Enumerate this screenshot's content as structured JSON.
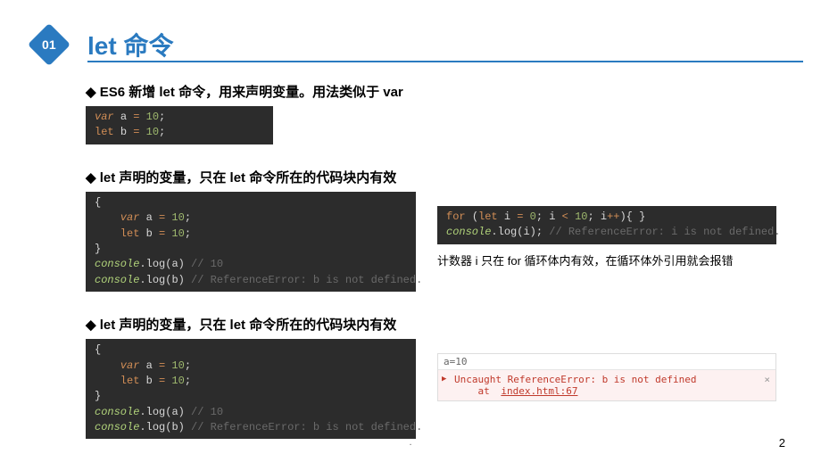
{
  "slide": {
    "badge": "01",
    "title": "let 命令",
    "page_number": "2",
    "footer_mark": "."
  },
  "sections": [
    {
      "heading": "ES6 新增 let 命令，用来声明变量。用法类似于 var",
      "code1": [
        {
          "segments": [
            {
              "t": "var ",
              "c": "kw-orange"
            },
            {
              "t": "a ",
              "c": "varname"
            },
            {
              "t": "= ",
              "c": "op"
            },
            {
              "t": "10",
              "c": "num"
            },
            {
              "t": ";",
              "c": "varname"
            }
          ]
        },
        {
          "segments": [
            {
              "t": "let ",
              "c": "kw-let"
            },
            {
              "t": "b ",
              "c": "varname"
            },
            {
              "t": "= ",
              "c": "op"
            },
            {
              "t": "10",
              "c": "num"
            },
            {
              "t": ";",
              "c": "varname"
            }
          ]
        }
      ]
    },
    {
      "heading": "let 声明的变量，只在 let 命令所在的代码块内有效",
      "code_left": [
        {
          "segments": [
            {
              "t": "{",
              "c": "varname"
            }
          ]
        },
        {
          "segments": [
            {
              "t": "    var ",
              "c": "kw-orange"
            },
            {
              "t": "a ",
              "c": "varname"
            },
            {
              "t": "= ",
              "c": "op"
            },
            {
              "t": "10",
              "c": "num"
            },
            {
              "t": ";",
              "c": "varname"
            }
          ]
        },
        {
          "segments": [
            {
              "t": "    let ",
              "c": "kw-let"
            },
            {
              "t": "b ",
              "c": "varname"
            },
            {
              "t": "= ",
              "c": "op"
            },
            {
              "t": "10",
              "c": "num"
            },
            {
              "t": ";",
              "c": "varname"
            }
          ]
        },
        {
          "segments": [
            {
              "t": "}",
              "c": "varname"
            }
          ]
        },
        {
          "segments": [
            {
              "t": "console",
              "c": "ident"
            },
            {
              "t": ".log(",
              "c": "fn"
            },
            {
              "t": "a",
              "c": "varname"
            },
            {
              "t": ") ",
              "c": "fn"
            },
            {
              "t": "// 10",
              "c": "comment"
            }
          ]
        },
        {
          "segments": [
            {
              "t": "console",
              "c": "ident"
            },
            {
              "t": ".log(",
              "c": "fn"
            },
            {
              "t": "b",
              "c": "varname"
            },
            {
              "t": ") ",
              "c": "fn"
            },
            {
              "t": "// ReferenceError: b is not defined.",
              "c": "comment"
            }
          ]
        }
      ],
      "code_right": [
        {
          "segments": [
            {
              "t": "for ",
              "c": "for-kw"
            },
            {
              "t": "(",
              "c": "fn"
            },
            {
              "t": "let ",
              "c": "kw-let"
            },
            {
              "t": "i ",
              "c": "varname"
            },
            {
              "t": "= ",
              "c": "op"
            },
            {
              "t": "0",
              "c": "num"
            },
            {
              "t": "; i ",
              "c": "varname"
            },
            {
              "t": "< ",
              "c": "op"
            },
            {
              "t": "10",
              "c": "num"
            },
            {
              "t": "; i",
              "c": "varname"
            },
            {
              "t": "++",
              "c": "op"
            },
            {
              "t": "){ }",
              "c": "fn"
            }
          ]
        },
        {
          "segments": [
            {
              "t": "console",
              "c": "ident"
            },
            {
              "t": ".log(",
              "c": "fn"
            },
            {
              "t": "i",
              "c": "varname"
            },
            {
              "t": "); ",
              "c": "fn"
            },
            {
              "t": "// ReferenceError: i is not defined.",
              "c": "comment"
            }
          ]
        }
      ],
      "right_note": "计数器 i 只在 for 循环体内有效，在循环体外引用就会报错"
    },
    {
      "heading": "let 声明的变量，只在 let 命令所在的代码块内有效",
      "code_left": [
        {
          "segments": [
            {
              "t": "{",
              "c": "varname"
            }
          ]
        },
        {
          "segments": [
            {
              "t": "    var ",
              "c": "kw-orange"
            },
            {
              "t": "a ",
              "c": "varname"
            },
            {
              "t": "= ",
              "c": "op"
            },
            {
              "t": "10",
              "c": "num"
            },
            {
              "t": ";",
              "c": "varname"
            }
          ]
        },
        {
          "segments": [
            {
              "t": "    let ",
              "c": "kw-let"
            },
            {
              "t": "b ",
              "c": "varname"
            },
            {
              "t": "= ",
              "c": "op"
            },
            {
              "t": "10",
              "c": "num"
            },
            {
              "t": ";",
              "c": "varname"
            }
          ]
        },
        {
          "segments": [
            {
              "t": "}",
              "c": "varname"
            }
          ]
        },
        {
          "segments": [
            {
              "t": "console",
              "c": "ident"
            },
            {
              "t": ".log(",
              "c": "fn"
            },
            {
              "t": "a",
              "c": "varname"
            },
            {
              "t": ") ",
              "c": "fn"
            },
            {
              "t": "// 10",
              "c": "comment"
            }
          ]
        },
        {
          "segments": [
            {
              "t": "console",
              "c": "ident"
            },
            {
              "t": ".log(",
              "c": "fn"
            },
            {
              "t": "b",
              "c": "varname"
            },
            {
              "t": ") ",
              "c": "fn"
            },
            {
              "t": "// ReferenceError: b is not defined.",
              "c": "comment"
            }
          ]
        }
      ],
      "console": {
        "top_line": "a=10",
        "error_main": "Uncaught ReferenceError: b is not defined",
        "error_at": "at ",
        "error_link": "index.html:67"
      }
    }
  ]
}
